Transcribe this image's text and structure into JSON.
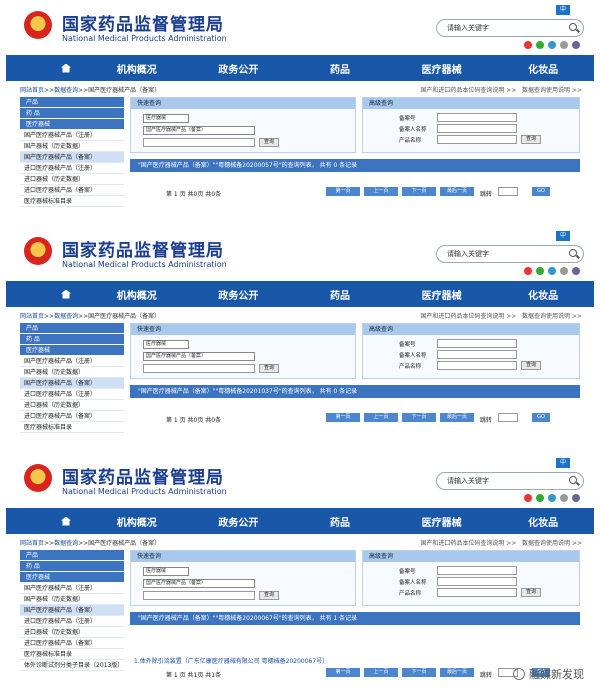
{
  "header": {
    "title_cn": "国家药品监督管理局",
    "title_en": "National Medical Products Administration",
    "lang": "中",
    "search_placeholder": "请输入关键字"
  },
  "nav": [
    "机构概况",
    "政务公开",
    "药品",
    "医疗器械",
    "化妆品"
  ],
  "crumb": {
    "home": "网站首页",
    "data": "数据查询",
    "sep": ">>",
    "current": "国产医疗器械产品（备案）",
    "right1": "国产和进口药品本位码查询说明 >>",
    "right2": "数据查询使用说明 >>"
  },
  "sidebar": {
    "h1": "产品",
    "h2": "药 品",
    "h3": "医疗器械",
    "items": [
      "国产医疗器械产品（注册）",
      "国产器械（历史数据）",
      "国产医疗器械产品（备案）",
      "进口医疗器械产品（注册）",
      "进口器械（历史数据）",
      "进口医疗器械产品（备案）",
      "医疗器械标准目录",
      "体外诊断试剂分类子目录（2013版）"
    ]
  },
  "quick": {
    "title": "快速查询",
    "opt1": "医疗器械",
    "opt2": "国产医疗器械产品（备案）",
    "query": "查询"
  },
  "advanced": {
    "title": "高级查询",
    "f1": "备案号",
    "f2": "备案人名称",
    "f3": "产品名称",
    "query": "查询"
  },
  "screens": [
    {
      "bar": "\"国产医疗器械产品（备案）\"\"粤穗械备20200057号\"的查询列表， 共有 0 条记录",
      "pager": "第 1 页 共0页 共0条"
    },
    {
      "bar": "\"国产医疗器械产品（备案）\"\"粤穗械备20201037号\"的查询列表， 共有 0 条记录",
      "pager": "第 1 页 共0页 共0条"
    },
    {
      "bar": "\"国产医疗器械产品（备案）\"\"粤穗械备20200067号\"的查询列表， 共有 1 条记录",
      "pager": "第 1 页 共1页 共1条",
      "result": "1.体外除引流装置（广东亿康医疗器械有限公司 粤穗械备20200067号）"
    }
  ],
  "pager_buttons": [
    "第一页",
    "上一页",
    "下一页",
    "最后一页"
  ],
  "jump": "跳转",
  "go": "GO",
  "watermark": "融媒新发现",
  "colors": {
    "nav": "#1957a8",
    "brand": "#1a3d8f"
  }
}
